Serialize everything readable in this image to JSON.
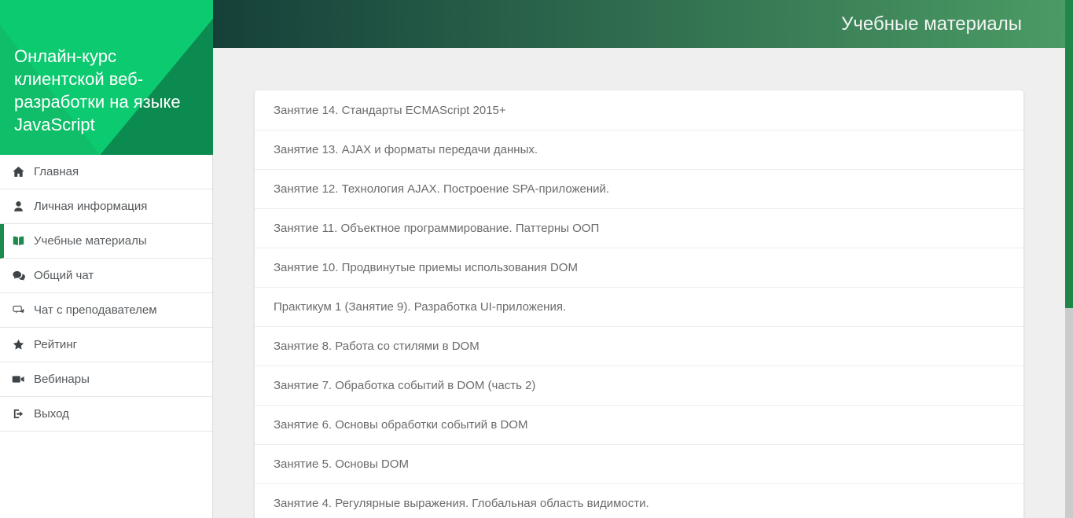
{
  "sidebar": {
    "course_title": "Онлайн-курс клиентской веб-разработки на языке JavaScript",
    "items": [
      {
        "id": "home",
        "label": "Главная",
        "icon": "home-icon",
        "active": false
      },
      {
        "id": "profile",
        "label": "Личная информация",
        "icon": "user-icon",
        "active": false
      },
      {
        "id": "materials",
        "label": "Учебные материалы",
        "icon": "book-icon",
        "active": true
      },
      {
        "id": "group-chat",
        "label": "Общий чат",
        "icon": "chat-group-icon",
        "active": false
      },
      {
        "id": "teacher-chat",
        "label": "Чат с преподавателем",
        "icon": "chat-teacher-icon",
        "active": false
      },
      {
        "id": "rating",
        "label": "Рейтинг",
        "icon": "star-icon",
        "active": false
      },
      {
        "id": "webinars",
        "label": "Вебинары",
        "icon": "video-icon",
        "active": false
      },
      {
        "id": "logout",
        "label": "Выход",
        "icon": "logout-icon",
        "active": false
      }
    ]
  },
  "header": {
    "title": "Учебные материалы"
  },
  "materials": {
    "items": [
      "Занятие 14. Стандарты ECMAScript 2015+",
      "Занятие 13. AJAX и форматы передачи данных.",
      "Занятие 12. Технология AJAX. Построение SPA-приложений.",
      "Занятие 11. Объектное программирование. Паттерны ООП",
      "Занятие 10. Продвинутые приемы использования DOM",
      "Практикум 1 (Занятие 9). Разработка UI-приложения.",
      "Занятие 8. Работа со стилями в DOM",
      "Занятие 7. Обработка событий в DOM (часть 2)",
      "Занятие 6. Основы обработки событий в DOM",
      "Занятие 5. Основы DOM",
      "Занятие 4. Регулярные выражения. Глобальная область видимости."
    ]
  },
  "colors": {
    "accent_green": "#0cca70",
    "banner_mid_green": "#10bd69",
    "banner_dark_green": "#0b8b50",
    "header_gradient_start": "#15403a",
    "header_gradient_end": "#4b9b64",
    "active_item_green": "#1f8a4e",
    "scrollbar_thumb_green": "#218749"
  }
}
